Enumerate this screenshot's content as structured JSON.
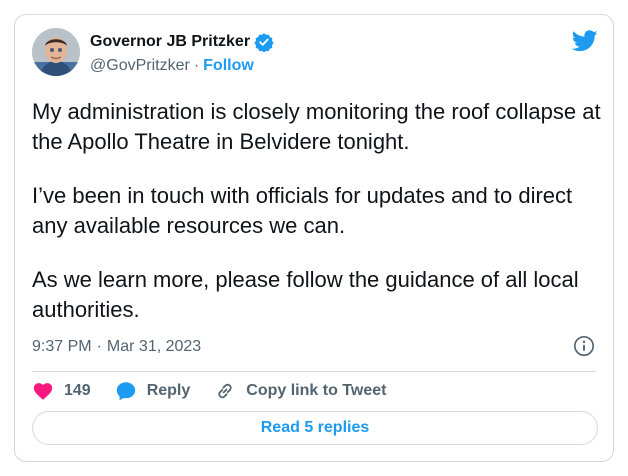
{
  "author": {
    "display_name": "Governor JB Pritzker",
    "handle": "@GovPritzker",
    "separator": "·",
    "follow_label": "Follow",
    "avatar_icon": "avatar-photo",
    "verified_icon": "verified-badge-icon"
  },
  "platform_icon": "twitter-bird-icon",
  "tweet": {
    "paragraphs": [
      "My administration is closely monitoring the roof collapse at the Apollo Theatre in Belvidere tonight.",
      "I’ve been in touch with officials for updates and to direct any available resources we can.",
      "As we learn more, please follow the guidance of all local authorities."
    ],
    "time": "9:37 PM",
    "separator": "·",
    "date": "Mar 31, 2023"
  },
  "actions": {
    "like_count": "149",
    "reply_label": "Reply",
    "copy_link_label": "Copy link to Tweet"
  },
  "replies_button_label": "Read 5 replies",
  "colors": {
    "accent": "#1d9bf0",
    "like": "#f91880",
    "text": "#0f1419",
    "muted": "#536471",
    "border": "#cfd9de"
  }
}
